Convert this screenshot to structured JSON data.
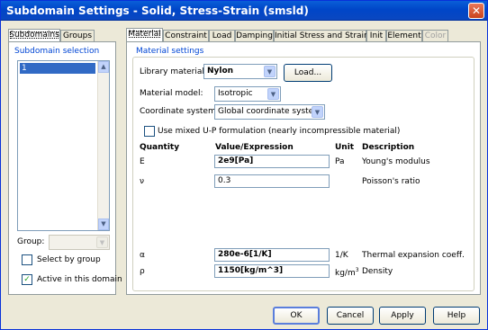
{
  "window": {
    "title": "Subdomain Settings - Solid, Stress-Strain (smsld)",
    "close_glyph": "✕"
  },
  "left_tabs": [
    "Subdomains",
    "Groups"
  ],
  "left_panel": {
    "selection_label": "Subdomain selection",
    "selected_item": "1",
    "group_label": "Group:",
    "group_value": "",
    "select_by_group_label": "Select by group",
    "select_by_group_checked": false,
    "active_label": "Active in this domain",
    "active_checked": true
  },
  "right_tabs": [
    "Material",
    "Constraint",
    "Load",
    "Damping",
    "Initial Stress and Strain",
    "Init",
    "Element",
    "Color"
  ],
  "material": {
    "section_label": "Material settings",
    "library_label": "Library material:",
    "library_value": "Nylon",
    "load_button": "Load...",
    "model_label": "Material model:",
    "model_value": "Isotropic",
    "coord_label": "Coordinate system:",
    "coord_value": "Global coordinate system",
    "mixed_up_label": "Use mixed U-P formulation (nearly incompressible material)",
    "mixed_up_checked": false,
    "headers": {
      "quantity": "Quantity",
      "value": "Value/Expression",
      "unit": "Unit",
      "description": "Description"
    },
    "rows": [
      {
        "quantity": "E",
        "value": "2e9[Pa]",
        "unit": "Pa",
        "description": "Young's modulus"
      },
      {
        "quantity": "ν",
        "value": "0.3",
        "unit": "",
        "description": "Poisson's ratio"
      },
      {
        "quantity": "α",
        "value": "280e-6[1/K]",
        "unit": "1/K",
        "description": "Thermal expansion coeff."
      },
      {
        "quantity": "ρ",
        "value": "1150[kg/m^3]",
        "unit_base": "kg/m",
        "unit_sup": "3",
        "description": "Density"
      }
    ]
  },
  "buttons": {
    "ok": "OK",
    "cancel": "Cancel",
    "apply": "Apply",
    "help": "Help"
  },
  "icons": {
    "scroll_up": "up-arrow-icon",
    "scroll_down": "down-arrow-icon",
    "dropdown": "chevron-down-icon"
  }
}
